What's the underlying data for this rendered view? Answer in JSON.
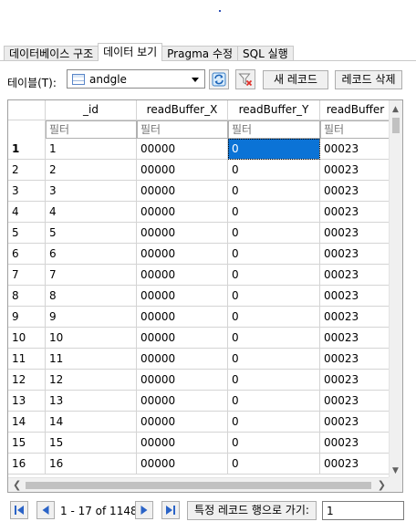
{
  "tabs": [
    {
      "label": "데이터베이스 구조",
      "active": false
    },
    {
      "label": "데이터 보기",
      "active": true
    },
    {
      "label": "Pragma 수정",
      "active": false
    },
    {
      "label": "SQL 실행",
      "active": false
    }
  ],
  "toolbar": {
    "table_label": "테이블(T):",
    "table_value": "andgle",
    "new_record": "새 레코드",
    "delete_record": "레코드 삭제"
  },
  "grid": {
    "columns": [
      "_id",
      "readBuffer_X",
      "readBuffer_Y",
      "readBuffer"
    ],
    "filter_placeholder": "필터",
    "rows": [
      {
        "n": "1",
        "id": "1",
        "x": "00000",
        "y": "0",
        "z": "00023"
      },
      {
        "n": "2",
        "id": "2",
        "x": "00000",
        "y": "0",
        "z": "00023"
      },
      {
        "n": "3",
        "id": "3",
        "x": "00000",
        "y": "0",
        "z": "00023"
      },
      {
        "n": "4",
        "id": "4",
        "x": "00000",
        "y": "0",
        "z": "00023"
      },
      {
        "n": "5",
        "id": "5",
        "x": "00000",
        "y": "0",
        "z": "00023"
      },
      {
        "n": "6",
        "id": "6",
        "x": "00000",
        "y": "0",
        "z": "00023"
      },
      {
        "n": "7",
        "id": "7",
        "x": "00000",
        "y": "0",
        "z": "00023"
      },
      {
        "n": "8",
        "id": "8",
        "x": "00000",
        "y": "0",
        "z": "00023"
      },
      {
        "n": "9",
        "id": "9",
        "x": "00000",
        "y": "0",
        "z": "00023"
      },
      {
        "n": "10",
        "id": "10",
        "x": "00000",
        "y": "0",
        "z": "00023"
      },
      {
        "n": "11",
        "id": "11",
        "x": "00000",
        "y": "0",
        "z": "00023"
      },
      {
        "n": "12",
        "id": "12",
        "x": "00000",
        "y": "0",
        "z": "00023"
      },
      {
        "n": "13",
        "id": "13",
        "x": "00000",
        "y": "0",
        "z": "00023"
      },
      {
        "n": "14",
        "id": "14",
        "x": "00000",
        "y": "0",
        "z": "00023"
      },
      {
        "n": "15",
        "id": "15",
        "x": "00000",
        "y": "0",
        "z": "00023"
      },
      {
        "n": "16",
        "id": "16",
        "x": "00000",
        "y": "0",
        "z": "00023"
      }
    ]
  },
  "nav": {
    "status": "1 - 17 of 1148",
    "goto_label": "특정 레코드 행으로 가기:",
    "goto_value": "1"
  },
  "colors": {
    "selection": "#0b73d6"
  },
  "icons": [
    "table-icon",
    "refresh-icon",
    "clear-filter-icon",
    "first-record-icon",
    "prev-record-icon",
    "next-record-icon",
    "last-record-icon"
  ]
}
